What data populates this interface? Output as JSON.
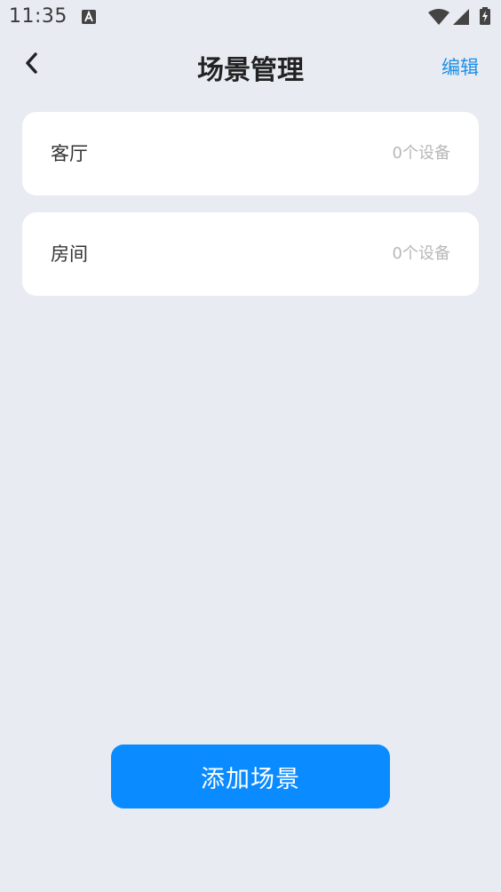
{
  "status_bar": {
    "time": "11:35"
  },
  "header": {
    "title": "场景管理",
    "edit_label": "编辑"
  },
  "scenes": [
    {
      "name": "客厅",
      "device_count": "0个设备"
    },
    {
      "name": "房间",
      "device_count": "0个设备"
    }
  ],
  "footer": {
    "add_label": "添加场景"
  },
  "colors": {
    "background": "#e8ebf2",
    "accent": "#1890e8",
    "button": "#0a8bff"
  }
}
